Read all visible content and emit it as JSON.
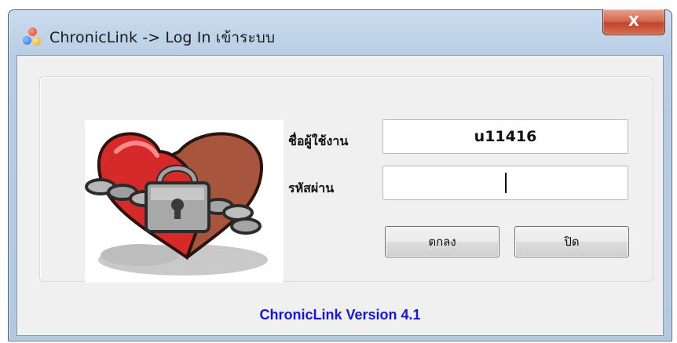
{
  "window": {
    "title": "ChronicLink -> Log In เข้าระบบ",
    "close_label": "X"
  },
  "form": {
    "username_label": "ชื่อผู้ใช้งาน",
    "username_value": "u11416",
    "password_label": "รหัสผ่าน",
    "password_value": ""
  },
  "buttons": {
    "ok_label": "ตกลง",
    "close_label": "ปิด"
  },
  "footer": {
    "version_text": "ChronicLink Version 4.1",
    "version_color": "#1515e0"
  },
  "image": {
    "icon": "heart-with-chain-and-padlock"
  },
  "colors": {
    "close_button": "#c0452c",
    "heart": "#d62a2a"
  }
}
